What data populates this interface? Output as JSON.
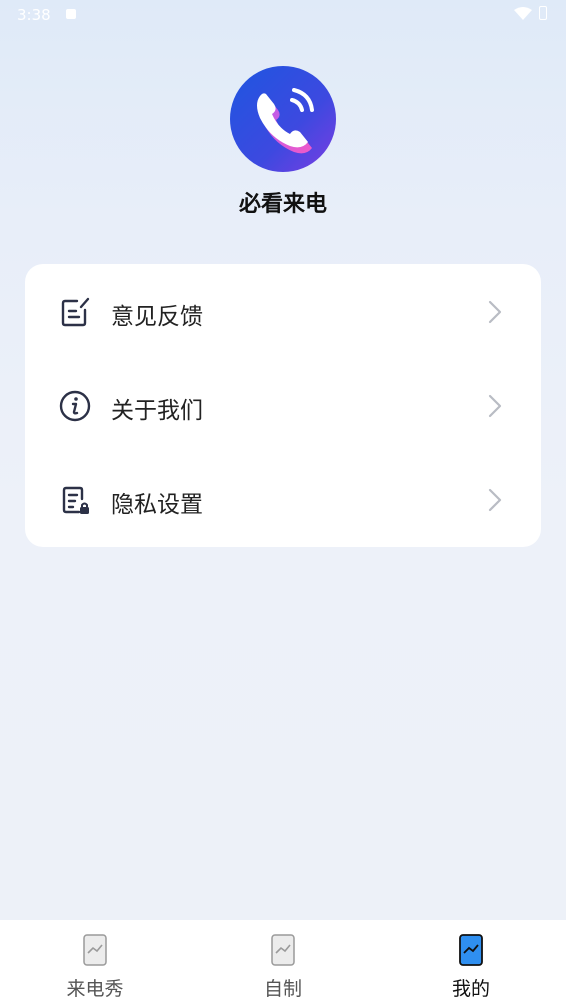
{
  "status_bar": {
    "time": "3:38"
  },
  "app": {
    "name": "必看来电"
  },
  "menu": {
    "items": [
      {
        "label": "意见反馈",
        "icon": "feedback-edit-icon"
      },
      {
        "label": "关于我们",
        "icon": "info-circle-icon"
      },
      {
        "label": "隐私设置",
        "icon": "privacy-document-lock-icon"
      }
    ]
  },
  "tabs": [
    {
      "label": "来电秀",
      "icon": "image-placeholder-icon",
      "active": false
    },
    {
      "label": "自制",
      "icon": "image-placeholder-icon",
      "active": false
    },
    {
      "label": "我的",
      "icon": "image-placeholder-icon",
      "active": true
    }
  ],
  "colors": {
    "accent": "#2f8ff0",
    "logo_blue": "#2a4fd8",
    "logo_purple": "#7a3ce0",
    "logo_pink": "#e84fc8"
  }
}
